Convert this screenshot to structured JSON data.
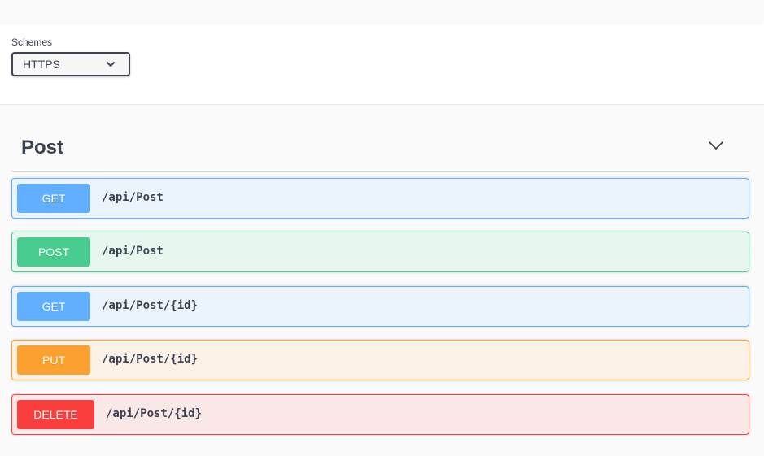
{
  "schemes": {
    "label": "Schemes",
    "selected": "HTTPS"
  },
  "tag": {
    "name": "Post"
  },
  "operations": [
    {
      "method": "GET",
      "path": "/api/Post"
    },
    {
      "method": "POST",
      "path": "/api/Post"
    },
    {
      "method": "GET",
      "path": "/api/Post/{id}"
    },
    {
      "method": "PUT",
      "path": "/api/Post/{id}"
    },
    {
      "method": "DELETE",
      "path": "/api/Post/{id}"
    }
  ],
  "colors": {
    "get": "#61affe",
    "post": "#49cc90",
    "put": "#fca130",
    "delete": "#f93e3e",
    "text": "#3b4151"
  },
  "icons": {
    "scheme_dropdown": "chevron-down-icon",
    "tag_toggle": "chevron-down-icon"
  }
}
